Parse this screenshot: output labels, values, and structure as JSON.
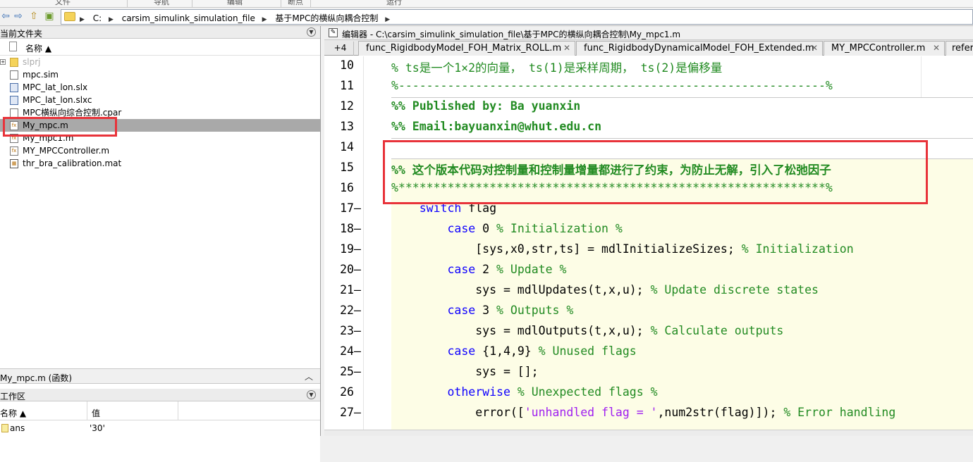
{
  "ribbon": {
    "labels": [
      "文件",
      "导航",
      "编辑",
      "断点",
      "运行"
    ]
  },
  "address": {
    "crumbs": [
      "C:",
      "carsim_simulink_simulation_file",
      "基于MPC的横纵向耦合控制"
    ]
  },
  "current_folder": {
    "title": "当前文件夹",
    "column_name": "名称 ▲",
    "files": [
      {
        "name": "slprj",
        "type": "folder"
      },
      {
        "name": "mpc.sim",
        "type": "file"
      },
      {
        "name": "MPC_lat_lon.slx",
        "type": "slx"
      },
      {
        "name": "MPC_lat_lon.slxc",
        "type": "slx"
      },
      {
        "name": "MPC横纵向综合控制.cpar",
        "type": "file"
      },
      {
        "name": "My_mpc.m",
        "type": "m"
      },
      {
        "name": "My_mpc1.m",
        "type": "m"
      },
      {
        "name": "MY_MPCController.m",
        "type": "m"
      },
      {
        "name": "thr_bra_calibration.mat",
        "type": "mat"
      }
    ]
  },
  "details": {
    "text": "My_mpc.m  (函数)"
  },
  "workspace": {
    "title": "工作区",
    "col_name": "名称 ▲",
    "col_value": "值",
    "rows": [
      {
        "name": "ans",
        "value": "'30'"
      }
    ]
  },
  "editor": {
    "title": "编辑器 - C:\\carsim_simulink_simulation_file\\基于MPC的横纵向耦合控制\\My_mpc1.m",
    "tab_more": "+4",
    "tabs": [
      "func_RigidbodyModel_FOH_Matrix_ROLL.m",
      "func_RigidbodyDynamicalModel_FOH_Extended.m",
      "MY_MPCController.m",
      "refer"
    ],
    "line_numbers": [
      "10",
      "11",
      "12",
      "13",
      "14",
      "15",
      "16",
      "17",
      "18",
      "19",
      "20",
      "21",
      "22",
      "23",
      "24",
      "25",
      "26",
      "27"
    ]
  },
  "colors": {
    "comment": "#228b22",
    "keyword": "#0e00ff",
    "string": "#a020f0",
    "highlight": "#e8333a"
  }
}
